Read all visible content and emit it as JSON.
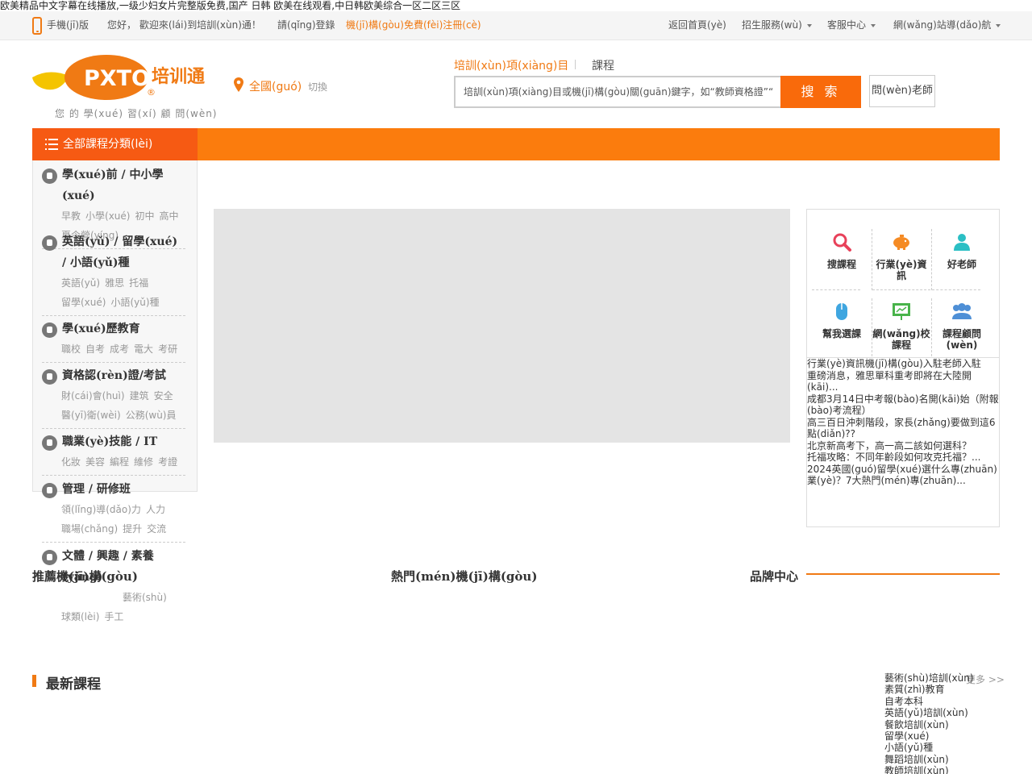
{
  "seo_line": "欧美精品中文字幕在线播放,一级少妇女片完整版免费,国产 日韩 欧美在线观看,中日韩欧美综合一区二区三区",
  "topbar": {
    "mobile": "手機(jī)版",
    "welcome": "您好， 歡迎來(lái)到培訓(xùn)通！",
    "login": "請(qǐng)登錄",
    "register": "機(jī)構(gòu)免費(fèi)注冊(cè)",
    "home": "返回首頁(yè)",
    "recruit": "招生服務(wù)",
    "service": "客服中心",
    "sitenav": "網(wǎng)站導(dǎo)航"
  },
  "header": {
    "logo_text": "PXTO",
    "logo_cn": "培训通",
    "logo_sub": "您 的 學(xué) 習(xí) 顧 問(wèn)",
    "city": "全國(guó)",
    "city_switch": "切換",
    "search_tab_1": "培訓(xùn)項(xiàng)目",
    "search_tab_2": "課程",
    "search_placeholder": "培訓(xùn)項(xiàng)目或機(jī)構(gòu)關(guān)鍵字，如“教師資格證”“優(yōu)",
    "search_button": "搜 索",
    "ask_button": "問(wèn)老師"
  },
  "nav": {
    "all_categories": "全部課程分類(lèi)"
  },
  "categories": [
    {
      "title": "學(xué)前 / 中小學(xué)",
      "subs": [
        [
          "早教",
          "小學(xué)",
          "初中",
          "高中"
        ],
        [
          "夏令營(yíng)"
        ]
      ]
    },
    {
      "title": "英語(yǔ) / 留學(xué) / 小語(yǔ)種",
      "subs": [
        [
          "英語(yǔ)",
          "雅思",
          "托福"
        ],
        [
          "留學(xué)",
          "小語(yǔ)種"
        ]
      ]
    },
    {
      "title": "學(xué)歷教育",
      "subs": [
        [
          "職校",
          "自考",
          "成考",
          "電大",
          "考研"
        ]
      ]
    },
    {
      "title": "資格認(rèn)證/考試",
      "subs": [
        [
          "財(cái)會(huì)",
          "建筑",
          "安全"
        ],
        [
          "醫(yī)衛(wèi)",
          "公務(wù)員"
        ]
      ]
    },
    {
      "title": "職業(yè)技能 / IT",
      "subs": [
        [
          "化妝",
          "美容",
          "編程",
          "維修",
          "考證"
        ]
      ]
    },
    {
      "title": "管理 / 研修班",
      "subs": [
        [
          "領(lǐng)導(dǎo)力",
          "人力"
        ],
        [
          "職場(chǎng)",
          "提升",
          "交流"
        ]
      ]
    },
    {
      "title": "文體 / 興趣 / 素養(yǎng)",
      "subs": [
        [
          "藝術(shù)"
        ],
        [
          "球類(lèi)",
          "手工"
        ]
      ]
    }
  ],
  "quick": [
    {
      "label": "搜課程",
      "icon": "search-icon"
    },
    {
      "label": "行業(yè)資訊",
      "icon": "piggy-bank-icon"
    },
    {
      "label": "好老師",
      "icon": "teacher-icon"
    },
    {
      "label": "幫我選課",
      "icon": "mouse-icon"
    },
    {
      "label": "網(wǎng)校課程",
      "icon": "presentation-icon"
    },
    {
      "label": "課程顧問(wèn)",
      "icon": "advisor-icon"
    }
  ],
  "news": [
    "行業(yè)資訊機(jī)構(gòu)入駐老師入駐",
    "重磅消息，雅思單科重考即將在大陸開(kāi)...",
    "成都3月14日中考報(bào)名開(kāi)始（附報(bào)考流程）",
    "高三百日沖刺階段，家長(zhǎng)要做到這6點(diǎn)??",
    "北京新高考下，高一高二該如何選科？",
    "托福攻略：不同年齡段如何攻克托福？...",
    "2024英國(guó)留學(xué)選什么專(zhuān)業(yè)？7大熱門(mén)專(zhuān)..."
  ],
  "sections": {
    "recommended": "推薦機(jī)構(gòu)",
    "hot": "熱門(mén)機(jī)構(gòu)",
    "brand": "品牌中心",
    "latest": "最新課程",
    "more": "更多 >>"
  },
  "tags": [
    "藝術(shù)培訓(xùn)",
    "素質(zhì)教育",
    "自考本科",
    "英語(yǔ)培訓(xùn)",
    "餐飲培訓(xùn)",
    "留學(xué)",
    "小語(yǔ)種",
    "舞蹈培訓(xùn)",
    "教師培訓(xùn)"
  ],
  "colors": {
    "accent": "#fb7c0d",
    "accent_dark": "#f65a13",
    "link_orange": "#f07a14"
  }
}
